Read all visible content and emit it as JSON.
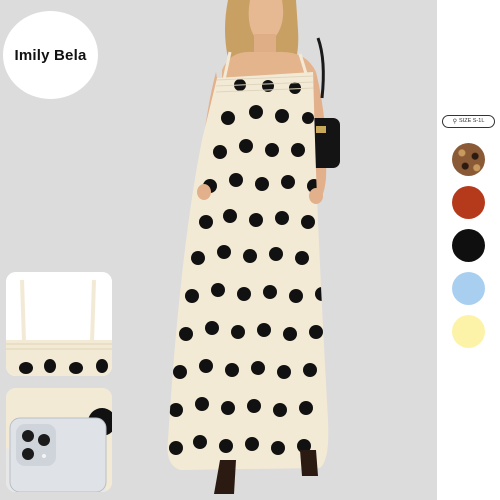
{
  "brand": {
    "name": "Imily Bela"
  },
  "size_tag": {
    "label": "SIZE S-1L",
    "icon": "search-icon"
  },
  "swatches": [
    {
      "name": "leopard",
      "color": "#8a5a36"
    },
    {
      "name": "rust",
      "color": "#b53a1c"
    },
    {
      "name": "black",
      "color": "#0f0f0f"
    },
    {
      "name": "light-blue",
      "color": "#a9cff0"
    },
    {
      "name": "light-yellow",
      "color": "#fdf3a8"
    }
  ],
  "colors": {
    "dress": "#f3ead6",
    "dot": "#111111",
    "background": "#dcdcdc"
  }
}
